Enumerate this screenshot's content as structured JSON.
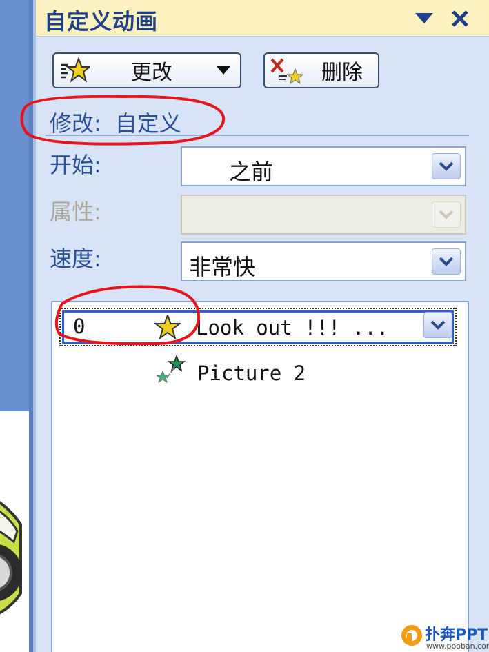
{
  "pane": {
    "title": "自定义动画",
    "change_button": "更改",
    "delete_button": "删除",
    "modify_label": "修改:",
    "modify_value": "自定义",
    "start_label": "开始:",
    "start_value": "之前",
    "property_label": "属性:",
    "property_value": "",
    "speed_label": "速度:",
    "speed_value": "非常快"
  },
  "list": {
    "items": [
      {
        "number": "0",
        "text": "Look out !!! ..."
      },
      {
        "text": "Picture 2"
      }
    ]
  },
  "colors": {
    "accent": "#1e3f86",
    "pane_bg": "#d6e4f6",
    "title_bg": "#fbf2c0",
    "annotation": "#e8141c",
    "selection": "#2d5fd2"
  },
  "icons": [
    "change-effect-star-icon",
    "dropdown-arrow-icon",
    "close-icon",
    "delete-effect-icon",
    "effect-star-icon",
    "path-animation-icon",
    "watermark-logo-icon"
  ],
  "watermark": {
    "brand": "扑奔PPT",
    "url": "www.pooban.com"
  }
}
